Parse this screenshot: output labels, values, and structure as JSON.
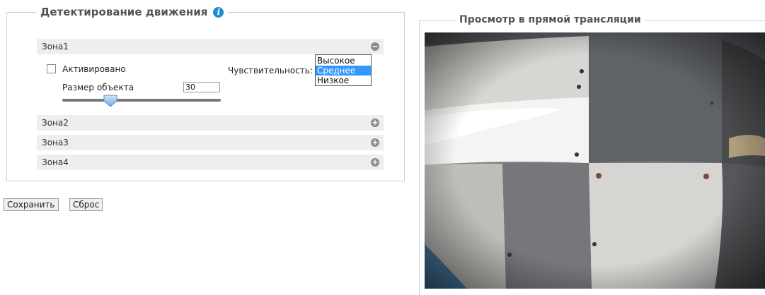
{
  "motion": {
    "title": "Детектирование движения",
    "info_icon": "i",
    "zones": [
      {
        "label": "Зона1",
        "expanded": true
      },
      {
        "label": "Зона2",
        "expanded": false
      },
      {
        "label": "Зона3",
        "expanded": false
      },
      {
        "label": "Зона4",
        "expanded": false
      }
    ],
    "activated_label": "Активировано",
    "activated_checked": false,
    "sensitivity_label": "Чувствительность:",
    "sensitivity_options": [
      "Высокое",
      "Среднее",
      "Низкое"
    ],
    "sensitivity_selected": "Среднее",
    "size_label": "Размер объекта",
    "size_value": "30",
    "collapse_symbol": "−",
    "expand_symbol": "+"
  },
  "buttons": {
    "save": "Сохранить",
    "reset": "Сброс"
  },
  "live": {
    "title": "Просмотр в прямой трансляции"
  },
  "colors": {
    "accent": "#1e8ad6",
    "selection": "#3399ff",
    "zone_bg": "#eeeeee"
  }
}
